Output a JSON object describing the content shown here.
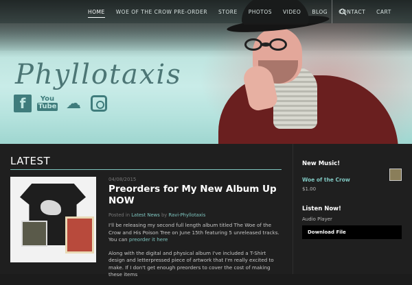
{
  "nav": {
    "items": [
      {
        "label": "HOME",
        "active": true
      },
      {
        "label": "WOE OF THE CROW PRE-ORDER",
        "active": false
      },
      {
        "label": "STORE",
        "active": false
      },
      {
        "label": "PHOTOS",
        "active": false
      },
      {
        "label": "VIDEO",
        "active": false
      },
      {
        "label": "BLOG",
        "active": false
      },
      {
        "label": "CONTACT",
        "active": false
      },
      {
        "label": "CART",
        "active": false
      }
    ],
    "search_icon": "search-icon"
  },
  "hero": {
    "title": "Phyllotaxis",
    "social": [
      {
        "icon": "facebook-icon",
        "label": "f"
      },
      {
        "icon": "youtube-icon",
        "label": "You",
        "sub": "Tube"
      },
      {
        "icon": "soundcloud-icon",
        "label": "☁"
      },
      {
        "icon": "instagram-icon",
        "label": ""
      }
    ]
  },
  "main": {
    "section_title": "LATEST",
    "post": {
      "date": "04/08/2015",
      "title": "Preorders for My New Album Up NOW",
      "meta_posted_in": "Posted in",
      "meta_category": "Latest News",
      "meta_by": "by",
      "meta_author": "Ravi-Phyllotaxis",
      "body_p1": "I'll be releasing my second full length album titled The Woe of the Crow and His Poison Tree on June 15th featuring 5 unreleased tracks.  You can",
      "body_p1_link": "preorder it here",
      "body_p2": "Along with the digital and physical album I've included a T-Shirt design and letterpressed piece of artwork that I'm really excited to make.  If I don't get enough preorders to cover the cost of making these items"
    }
  },
  "sidebar": {
    "new_music_title": "New Music!",
    "product_name": "Woe of the Crow",
    "product_price": "$1.00",
    "listen_title": "Listen Now!",
    "player_label": "Audio Player",
    "download_label": "Download File"
  },
  "colors": {
    "accent": "#7fc6c0",
    "background": "#1f1f1f",
    "jacket": "#6a1f1f"
  }
}
